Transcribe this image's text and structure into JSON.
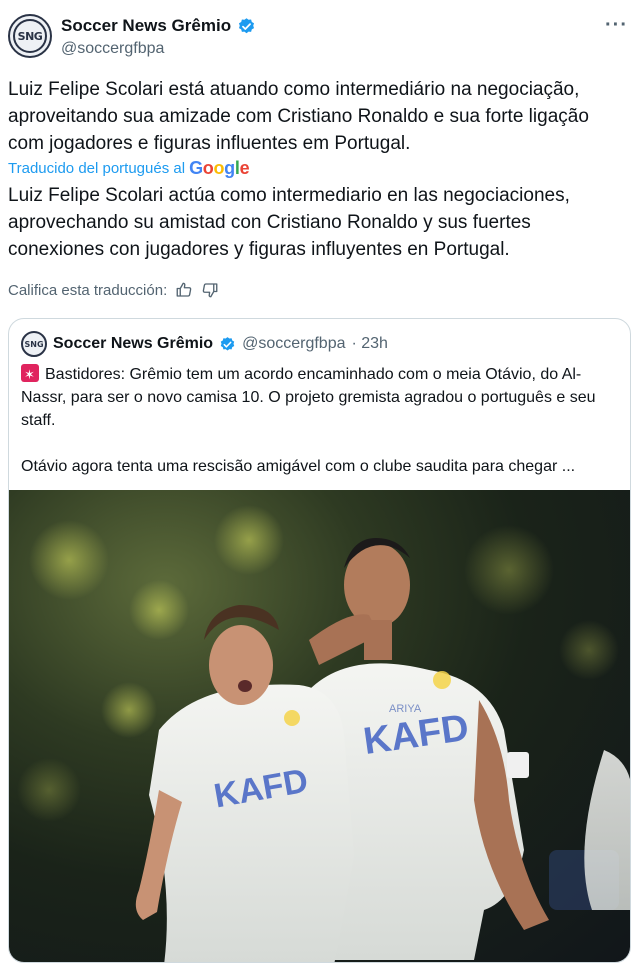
{
  "tweet": {
    "author_name": "Soccer News Grêmio",
    "author_handle": "@soccergfbpa",
    "avatar_text": "SNG",
    "more_label": "···",
    "original_text": "Luiz Felipe Scolari está atuando como intermediário na negociação, aproveitando sua amizade com Cristiano Ronaldo e sua forte ligação com jogadores e figuras influentes em Portugal.",
    "translated_by": "Traducido del portugués al",
    "translator_brand": "Google",
    "translated_text": "Luiz Felipe Scolari actúa como intermediario en las negociaciones, aprovechando su amistad con Cristiano Ronaldo y sus fuertes conexiones con jugadores y figuras influyentes en Portugal.",
    "rate_label": "Califica esta traducción:"
  },
  "quoted": {
    "author_name": "Soccer News Grêmio",
    "author_handle": "@soccergfbpa",
    "time": "· 23h",
    "avatar_text": "SNG",
    "line1": "Bastidores: Grêmio tem um acordo encaminhado com o meia Otávio, do Al-Nassr, para ser o novo camisa 10. O projeto gremista agradou o português e seu staff.",
    "line2": "Otávio agora tenta uma rescisão amigável com o clube saudita para chegar ...",
    "photo": {
      "jersey_text_left": "KAFD",
      "jersey_text_right": "KAFD",
      "sponsor": "ARIYA"
    }
  },
  "colors": {
    "link_blue": "#1d9bf0",
    "muted": "#536471",
    "border": "#cfd9de",
    "jersey": "#eef0ee",
    "jersey_print": "#5a76c9"
  }
}
